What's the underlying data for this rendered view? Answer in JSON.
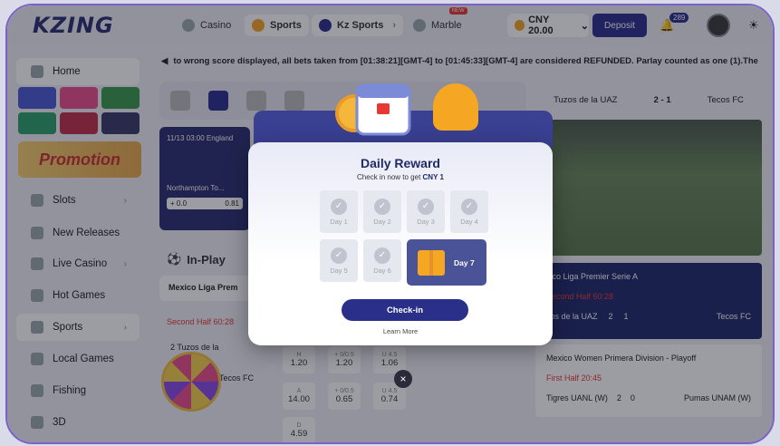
{
  "app": {
    "logo": "KZING"
  },
  "topnav": {
    "casino": "Casino",
    "sports": "Sports",
    "kzsports": "Kz Sports",
    "marble": "Marble",
    "marble_badge": "NEW"
  },
  "account": {
    "balance": "CNY 20.00",
    "deposit": "Deposit",
    "notifications": "289"
  },
  "ticker": "to wrong score displayed, all bets taken from [01:38:21][GMT-4] to [01:45:33][GMT-4] are considered REFUNDED. Parlay counted as one (1).The",
  "sidebar": {
    "home": "Home",
    "promotion": "Promotion",
    "items": [
      "Slots",
      "New Releases",
      "Live Casino",
      "Hot Games",
      "Sports",
      "Local Games",
      "Fishing",
      "3D"
    ]
  },
  "main": {
    "match_time": "11/13 03:00  England",
    "team": "Northampton To...",
    "odd_a": "+ 0.0",
    "odd_b": "0.81",
    "inplay": "In-Play",
    "league": "Mexico Liga Prem",
    "half": "Second Half 60:28",
    "team_home": "2   Tuzos de la",
    "team_away": "Tecos FC",
    "odds": [
      {
        "top": "H",
        "val": "1.20"
      },
      {
        "top": "+ 0/0.5",
        "val": "1.20"
      },
      {
        "top": "U 4.5",
        "val": "1.06"
      },
      {
        "top": "A",
        "val": "14.00"
      },
      {
        "top": "+ 0/0.5",
        "val": "0.65"
      },
      {
        "top": "U 4.5",
        "val": "0.74"
      },
      {
        "top": "D",
        "val": "4.59"
      }
    ]
  },
  "right": {
    "home": "Tuzos de la UAZ",
    "score": "2 - 1",
    "away": "Tecos FC",
    "card1_league": "xico Liga Premier Serie A",
    "card1_half": "Second Half 60:28",
    "card1_team": "zos de la UAZ",
    "card1_s1": "2",
    "card1_s2": "1",
    "card1_away": "Tecos FC",
    "card2_league": "Mexico Women Primera Division - Playoff",
    "card2_half": "First Half 20:45",
    "card2_home": "Tigres UANL (W)",
    "card2_s1": "2",
    "card2_s2": "0",
    "card2_away": "Pumas UNAM (W)"
  },
  "modal": {
    "title": "Daily Reward",
    "subtitle_prefix": "Check in now to get",
    "subtitle_amount": "CNY 1",
    "days": [
      "Day 1",
      "Day 2",
      "Day 3",
      "Day 4",
      "Day 5",
      "Day 6"
    ],
    "day7": "Day 7",
    "checkin": "Check-in",
    "learnmore": "Learn More",
    "close": "×"
  },
  "colors": {
    "primary": "#2a2f8a",
    "accent": "#f5a623",
    "live": "#e53935"
  }
}
